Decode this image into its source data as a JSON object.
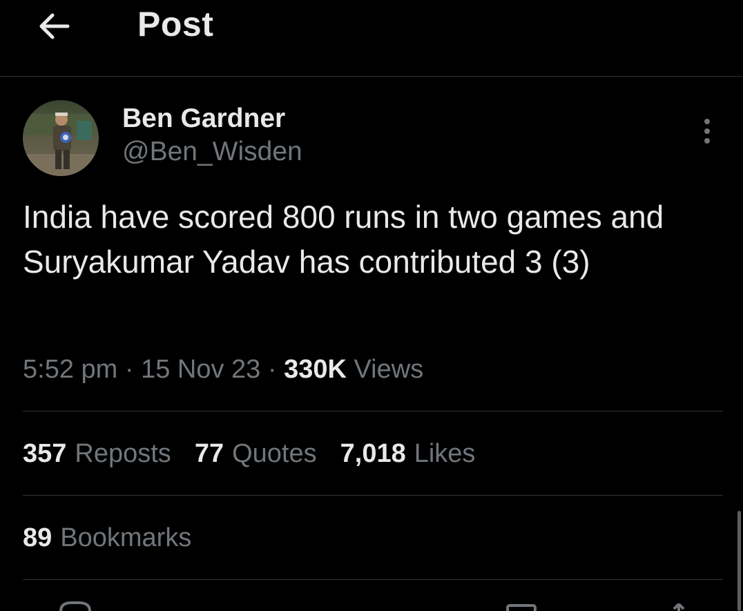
{
  "header": {
    "title": "Post",
    "back_icon": "arrow-left-icon"
  },
  "author": {
    "name": "Ben Gardner",
    "handle": "@Ben_Wisden"
  },
  "tweet": {
    "text": "India have scored 800 runs in two games and Suryakumar Yadav has contributed 3 (3)"
  },
  "meta": {
    "time": "5:52 pm",
    "date": "15 Nov 23",
    "views_count": "330K",
    "views_label": "Views",
    "separator": "·"
  },
  "stats": {
    "reposts_count": "357",
    "reposts_label": "Reposts",
    "quotes_count": "77",
    "quotes_label": "Quotes",
    "likes_count": "7,018",
    "likes_label": "Likes",
    "bookmarks_count": "89",
    "bookmarks_label": "Bookmarks"
  },
  "colors": {
    "background": "#000000",
    "primary_text": "#e7e9ea",
    "secondary_text": "#71767b",
    "divider": "#2f3336"
  }
}
